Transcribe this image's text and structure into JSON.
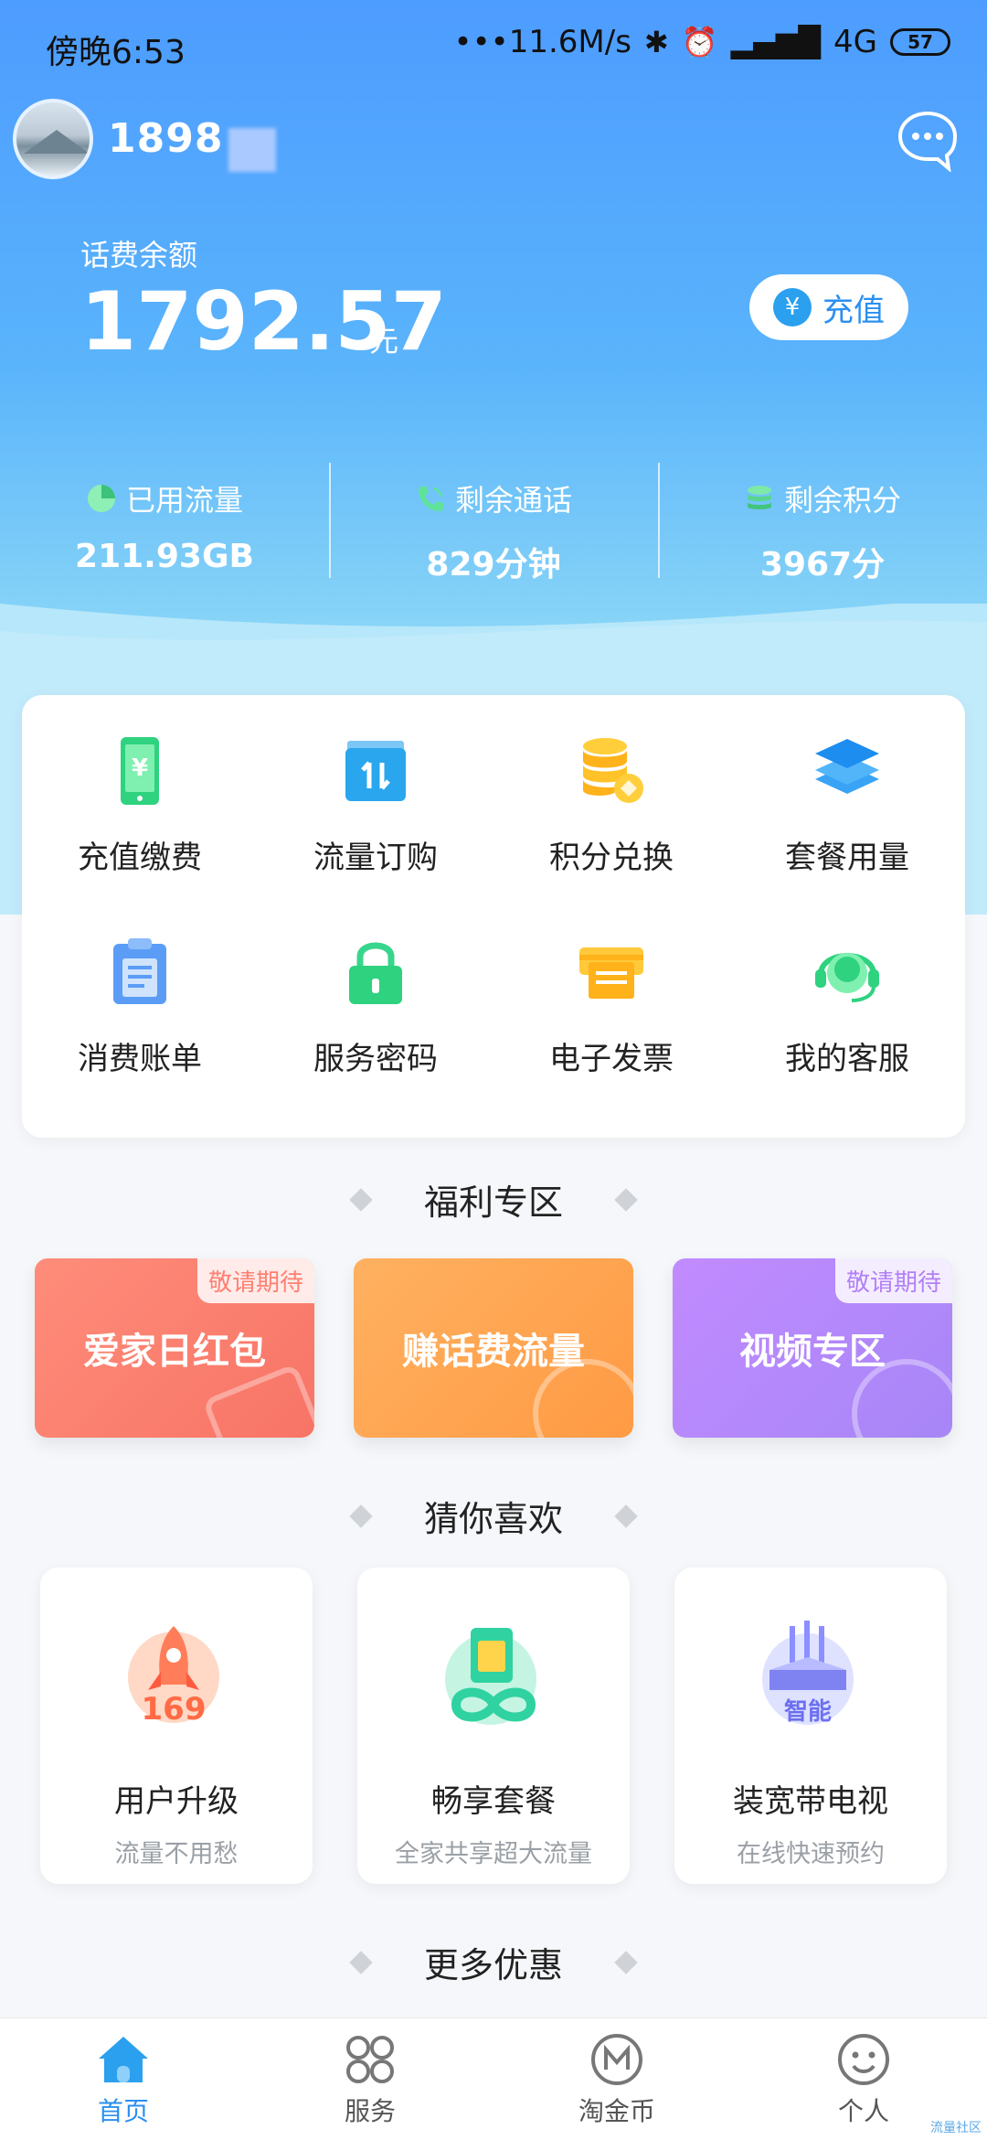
{
  "status_bar": {
    "time": "傍晚6:53",
    "network_speed": "•••11.6M/s",
    "network_type": "4G",
    "battery": "57"
  },
  "account": {
    "phone_number": "1898"
  },
  "balance": {
    "label": "话费余额",
    "value": "1792.57",
    "unit": "元",
    "recharge_label": "充值"
  },
  "stats": [
    {
      "label": "已用流量",
      "value": "211.93GB",
      "icon": "pie-chart-icon"
    },
    {
      "label": "剩余通话",
      "value": "829分钟",
      "icon": "phone-call-icon"
    },
    {
      "label": "剩余积分",
      "value": "3967分",
      "icon": "coins-icon"
    }
  ],
  "services": [
    {
      "label": "充值缴费",
      "icon": "phone-yen-icon"
    },
    {
      "label": "流量订购",
      "icon": "data-transfer-icon"
    },
    {
      "label": "积分兑换",
      "icon": "coin-stack-icon"
    },
    {
      "label": "套餐用量",
      "icon": "layers-icon"
    },
    {
      "label": "消费账单",
      "icon": "clipboard-icon"
    },
    {
      "label": "服务密码",
      "icon": "lock-icon"
    },
    {
      "label": "电子发票",
      "icon": "invoice-icon"
    },
    {
      "label": "我的客服",
      "icon": "headset-icon"
    }
  ],
  "welfare": {
    "title": "福利专区",
    "items": [
      {
        "label": "爱家日红包",
        "tag": "敬请期待",
        "deco": "¥10"
      },
      {
        "label": "赚话费流量",
        "tag": "",
        "deco": "¥"
      },
      {
        "label": "视频专区",
        "tag": "敬请期待",
        "deco": "play"
      }
    ]
  },
  "guess": {
    "title": "猜你喜欢",
    "items": [
      {
        "title": "用户升级",
        "subtitle": "流量不用愁",
        "icon": "rocket-169-icon"
      },
      {
        "title": "畅享套餐",
        "subtitle": "全家共享超大流量",
        "icon": "sim-infinity-icon"
      },
      {
        "title": "装宽带电视",
        "subtitle": "在线快速预约",
        "icon": "router-smart-icon"
      }
    ]
  },
  "more": {
    "title": "更多优惠"
  },
  "tabbar": [
    {
      "label": "首页",
      "active": true
    },
    {
      "label": "服务",
      "active": false
    },
    {
      "label": "淘金币",
      "active": false
    },
    {
      "label": "个人",
      "active": false
    }
  ],
  "watermark": "流量社区",
  "colors": {
    "primary": "#2a8ff0",
    "hero_top": "#4d9cff",
    "hero_bottom": "#bfeafb"
  }
}
